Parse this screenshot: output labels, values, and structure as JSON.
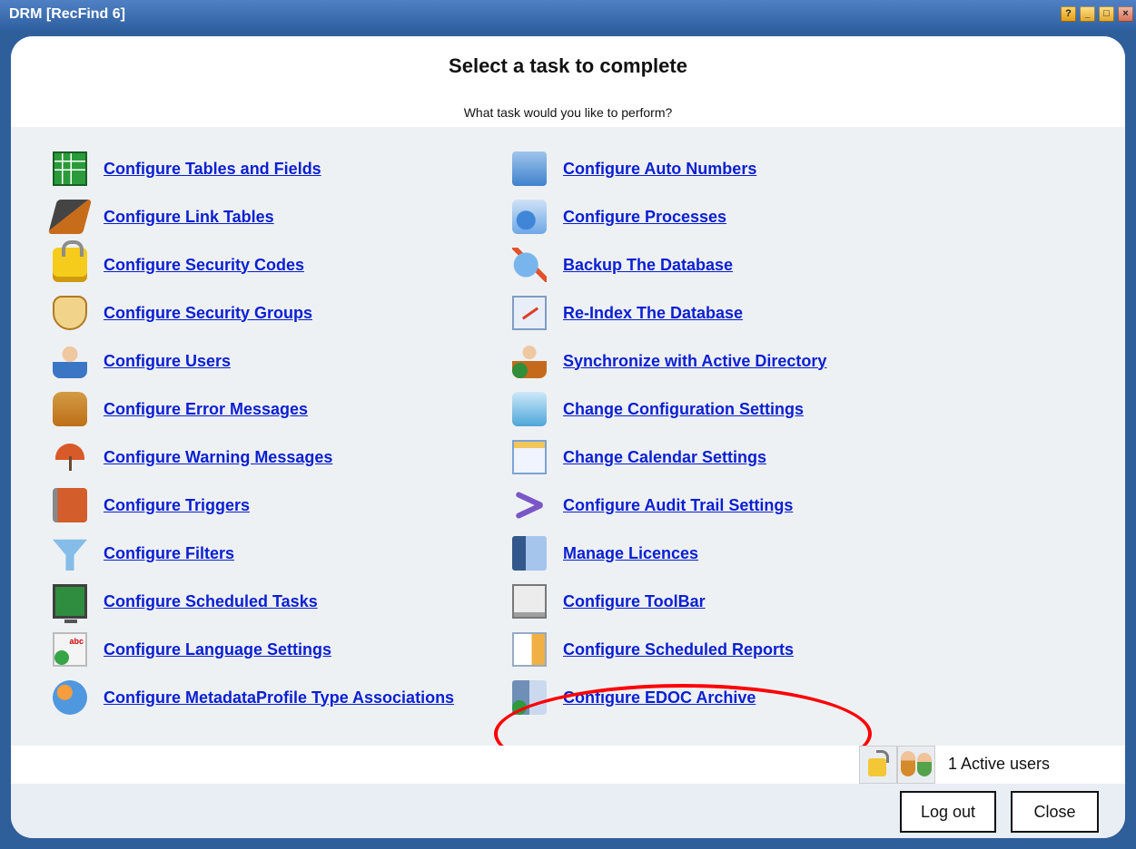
{
  "window": {
    "title": "DRM [RecFind 6]",
    "buttons": {
      "help": "?",
      "minimize": "_",
      "maximize": "□",
      "close": "×"
    }
  },
  "header": {
    "title": "Select a task to complete",
    "subtitle": "What task would you like to perform?"
  },
  "tasks": {
    "left": [
      {
        "label": "Configure Tables and Fields",
        "icon": "table-icon"
      },
      {
        "label": "Configure Link Tables",
        "icon": "link-table-icon"
      },
      {
        "label": "Configure Security Codes",
        "icon": "lock-icon"
      },
      {
        "label": "Configure Security Groups",
        "icon": "shield-icon"
      },
      {
        "label": "Configure Users",
        "icon": "user-icon"
      },
      {
        "label": "Configure Error Messages",
        "icon": "error-message-icon"
      },
      {
        "label": "Configure Warning Messages",
        "icon": "umbrella-icon"
      },
      {
        "label": "Configure Triggers",
        "icon": "trigger-icon"
      },
      {
        "label": "Configure Filters",
        "icon": "filter-icon"
      },
      {
        "label": "Configure Scheduled Tasks",
        "icon": "scheduled-task-icon"
      },
      {
        "label": "Configure Language Settings",
        "icon": "language-icon"
      },
      {
        "label": "Configure MetadataProfile Type Associations",
        "icon": "globe-icon"
      }
    ],
    "right": [
      {
        "label": "Configure Auto Numbers",
        "icon": "calculator-icon"
      },
      {
        "label": "Configure Processes",
        "icon": "process-icon"
      },
      {
        "label": "Backup The Database",
        "icon": "backup-icon"
      },
      {
        "label": "Re-Index The Database",
        "icon": "reindex-icon"
      },
      {
        "label": "Synchronize with Active Directory",
        "icon": "active-directory-icon"
      },
      {
        "label": "Change Configuration Settings",
        "icon": "configuration-icon"
      },
      {
        "label": "Change Calendar Settings",
        "icon": "calendar-icon"
      },
      {
        "label": "Configure Audit Trail Settings",
        "icon": "audit-trail-icon"
      },
      {
        "label": "Manage Licences",
        "icon": "licence-icon"
      },
      {
        "label": "Configure ToolBar",
        "icon": "toolbar-icon"
      },
      {
        "label": "Configure Scheduled Reports",
        "icon": "report-icon"
      },
      {
        "label": "Configure EDOC Archive",
        "icon": "edoc-archive-icon"
      }
    ]
  },
  "footer": {
    "active_users": "1 Active users",
    "logout_label": "Log out",
    "close_label": "Close"
  },
  "colors": {
    "link": "#0a1fd1",
    "title_bar": "#2f5f9a",
    "highlight": "#ff0000"
  }
}
